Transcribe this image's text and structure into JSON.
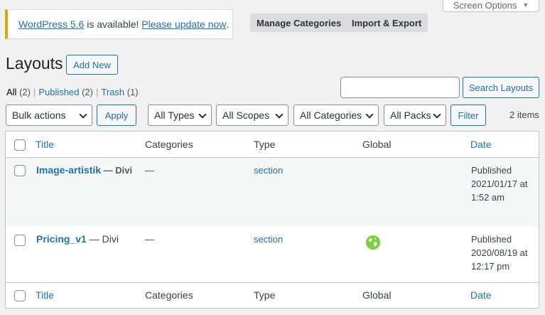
{
  "screen_options": {
    "label": "Screen Options"
  },
  "notice": {
    "version_link": "WordPress 5.6",
    "middle": " is available! ",
    "update_link": "Please update now",
    "end": "."
  },
  "tabs": {
    "manage": "Manage Categories",
    "import_export": "Import & Export"
  },
  "page": {
    "title": "Layouts",
    "add_new": "Add New"
  },
  "views": [
    {
      "label": "All",
      "count": "(2)"
    },
    {
      "label": "Published",
      "count": "(2)"
    },
    {
      "label": "Trash",
      "count": "(1)"
    }
  ],
  "views_sep": "|",
  "search": {
    "placeholder": "",
    "button": "Search Layouts"
  },
  "filters": {
    "bulk": "Bulk actions",
    "apply": "Apply",
    "types": "All Types",
    "scopes": "All Scopes",
    "categories": "All Categories",
    "packs": "All Packs",
    "filter": "Filter",
    "items_count": "2 items"
  },
  "columns": {
    "title": "Title",
    "categories": "Categories",
    "type": "Type",
    "global": "Global",
    "date": "Date"
  },
  "rows": [
    {
      "title": "Image-artistik",
      "suffix": " — Divi",
      "categories": "—",
      "type": "section",
      "global": false,
      "date_status": "Published",
      "date_line1": "2021/01/17 at",
      "date_line2": "1:52 am"
    },
    {
      "title": "Pricing_v1",
      "suffix": " — Divi",
      "categories": "—",
      "type": "section",
      "global": true,
      "date_status": "Published",
      "date_line1": "2020/08/19 at",
      "date_line2": "12:17 pm"
    }
  ],
  "icons": {
    "global": "globe-icon",
    "dropdown": "chevron-down-icon"
  },
  "colors": {
    "accent": "#2271b1",
    "notice_border": "#dba617",
    "global_icon": "#7ad03a"
  }
}
